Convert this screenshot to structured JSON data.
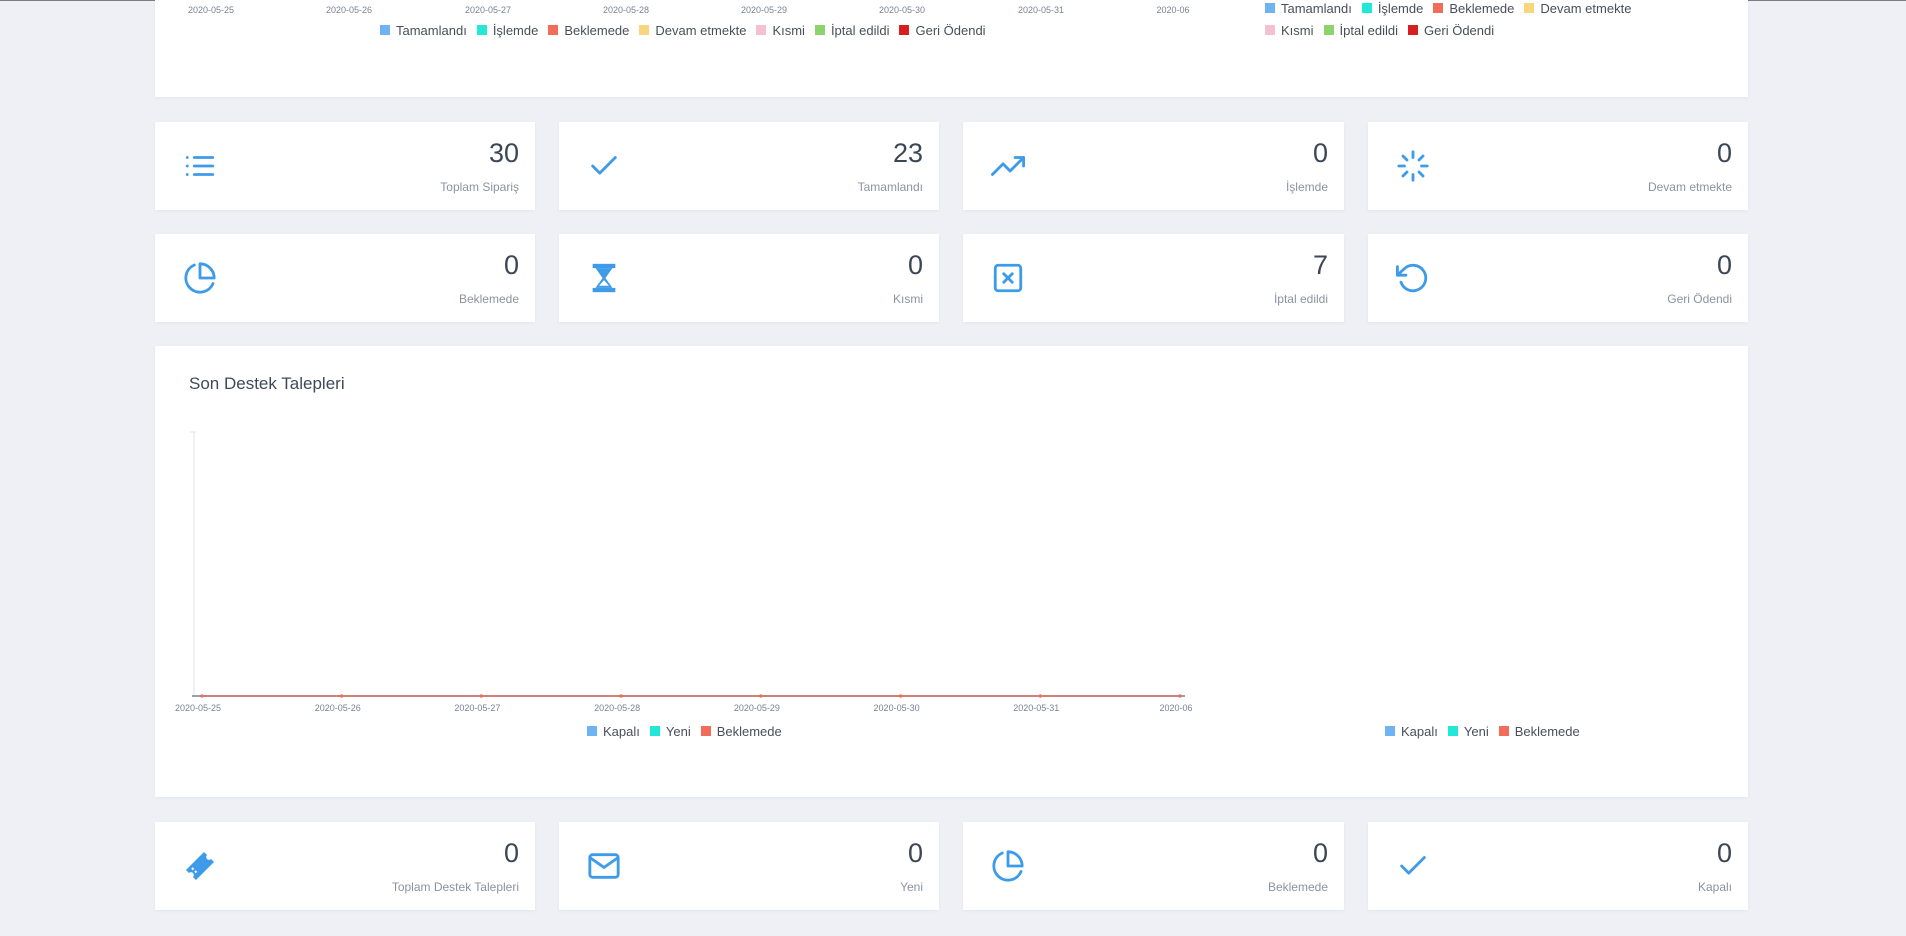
{
  "top_chart": {
    "x_labels": [
      "2020-05-25",
      "2020-05-26",
      "2020-05-27",
      "2020-05-28",
      "2020-05-29",
      "2020-05-30",
      "2020-05-31",
      "2020-06"
    ],
    "legend": [
      {
        "label": "Tamamlandı",
        "color": "#6fb3f2"
      },
      {
        "label": "İşlemde",
        "color": "#23e8d8"
      },
      {
        "label": "Beklemede",
        "color": "#f26c5a"
      },
      {
        "label": "Devam etmekte",
        "color": "#f9d57b"
      },
      {
        "label": "Kısmi",
        "color": "#f5c1cf"
      },
      {
        "label": "İptal edildi",
        "color": "#8cd36b"
      },
      {
        "label": "Geri Ödendi",
        "color": "#d71f1f"
      }
    ],
    "legend_right": [
      {
        "label": "Tamamlandı",
        "color": "#6fb3f2"
      },
      {
        "label": "İşlemde",
        "color": "#23e8d8"
      },
      {
        "label": "Beklemede",
        "color": "#f26c5a"
      },
      {
        "label": "Devam etmekte",
        "color": "#f9d57b"
      },
      {
        "label": "Kısmi",
        "color": "#f5c1cf"
      },
      {
        "label": "İptal edildi",
        "color": "#8cd36b"
      },
      {
        "label": "Geri Ödendi",
        "color": "#d71f1f"
      }
    ]
  },
  "order_stats": [
    {
      "value": "30",
      "label": "Toplam Sipariş",
      "icon": "list-icon"
    },
    {
      "value": "23",
      "label": "Tamamlandı",
      "icon": "check-icon"
    },
    {
      "value": "0",
      "label": "İşlemde",
      "icon": "trending-up-icon"
    },
    {
      "value": "0",
      "label": "Devam etmekte",
      "icon": "loader-icon"
    },
    {
      "value": "0",
      "label": "Beklemede",
      "icon": "pie-chart-icon"
    },
    {
      "value": "0",
      "label": "Kısmi",
      "icon": "hourglass-icon"
    },
    {
      "value": "7",
      "label": "İptal edildi",
      "icon": "x-square-icon"
    },
    {
      "value": "0",
      "label": "Geri Ödendi",
      "icon": "rotate-ccw-icon"
    }
  ],
  "support": {
    "title": "Son Destek Talepleri",
    "legend": [
      {
        "label": "Kapalı",
        "color": "#6fb3f2"
      },
      {
        "label": "Yeni",
        "color": "#23e8d8"
      },
      {
        "label": "Beklemede",
        "color": "#f26c5a"
      }
    ]
  },
  "chart_data": {
    "type": "line",
    "title": "Son Destek Talepleri",
    "categories": [
      "2020-05-25",
      "2020-05-26",
      "2020-05-27",
      "2020-05-28",
      "2020-05-29",
      "2020-05-30",
      "2020-05-31",
      "2020-06"
    ],
    "series": [
      {
        "name": "Kapalı",
        "values": [
          0,
          0,
          0,
          0,
          0,
          0,
          0,
          0
        ],
        "color": "#6fb3f2"
      },
      {
        "name": "Yeni",
        "values": [
          0,
          0,
          0,
          0,
          0,
          0,
          0,
          0
        ],
        "color": "#23e8d8"
      },
      {
        "name": "Beklemede",
        "values": [
          0,
          0,
          0,
          0,
          0,
          0,
          0,
          0
        ],
        "color": "#f26c5a"
      }
    ],
    "legend_placement": "bottom",
    "grid": false
  },
  "support_stats": [
    {
      "value": "0",
      "label": "Toplam Destek Talepleri",
      "icon": "ticket-icon"
    },
    {
      "value": "0",
      "label": "Yeni",
      "icon": "mail-icon"
    },
    {
      "value": "0",
      "label": "Beklemede",
      "icon": "pie-chart-icon"
    },
    {
      "value": "0",
      "label": "Kapalı",
      "icon": "check-icon"
    }
  ]
}
